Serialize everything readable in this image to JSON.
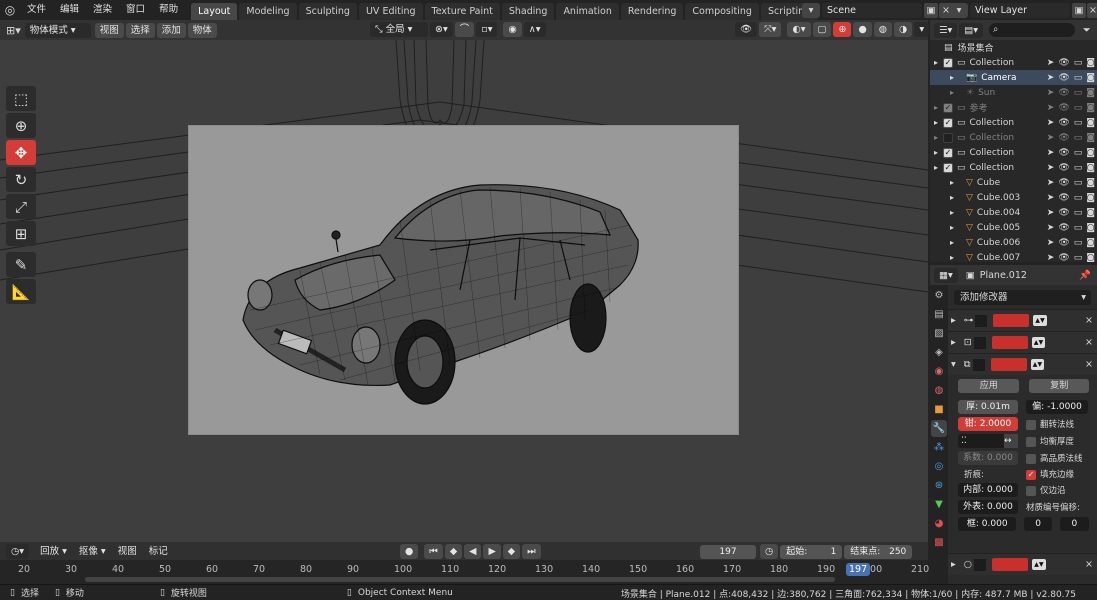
{
  "topbar": {
    "menus": [
      "文件",
      "编辑",
      "渲染",
      "窗口",
      "帮助"
    ],
    "tabs": [
      "Layout",
      "Modeling",
      "Sculpting",
      "UV Editing",
      "Texture Paint",
      "Shading",
      "Animation",
      "Rendering",
      "Compositing",
      "Scripting"
    ],
    "active_tab": "Layout",
    "scene": "Scene",
    "view_layer": "View Layer"
  },
  "viewport_header": {
    "mode": "物体模式",
    "menus": [
      "视图",
      "选择",
      "添加",
      "物体"
    ],
    "orientation": "全局"
  },
  "outliner": {
    "title": "场景集合",
    "rows": [
      {
        "label": "Collection",
        "checked": true,
        "dim": false,
        "kind": "collection"
      },
      {
        "label": "Camera",
        "checked": null,
        "dim": false,
        "kind": "camera",
        "selected": true
      },
      {
        "label": "Sun",
        "checked": null,
        "dim": true,
        "kind": "light"
      },
      {
        "label": "参考",
        "checked": true,
        "dim": true,
        "kind": "collection"
      },
      {
        "label": "Collection",
        "checked": true,
        "dim": false,
        "kind": "collection"
      },
      {
        "label": "Collection",
        "checked": false,
        "dim": true,
        "kind": "collection"
      },
      {
        "label": "Collection",
        "checked": true,
        "dim": false,
        "kind": "collection"
      },
      {
        "label": "Collection",
        "checked": true,
        "dim": false,
        "kind": "collection"
      },
      {
        "label": "Cube",
        "checked": null,
        "dim": false,
        "kind": "mesh"
      },
      {
        "label": "Cube.003",
        "checked": null,
        "dim": false,
        "kind": "mesh"
      },
      {
        "label": "Cube.004",
        "checked": null,
        "dim": false,
        "kind": "mesh"
      },
      {
        "label": "Cube.005",
        "checked": null,
        "dim": false,
        "kind": "mesh"
      },
      {
        "label": "Cube.006",
        "checked": null,
        "dim": false,
        "kind": "mesh"
      },
      {
        "label": "Cube.007",
        "checked": null,
        "dim": false,
        "kind": "mesh"
      }
    ]
  },
  "properties": {
    "object": "Plane.012",
    "add_modifier": "添加修改器",
    "apply": "应用",
    "copy": "复制",
    "thickness": "厚: 0.01m",
    "offset": "偏: -1.0000",
    "clamp": "钳: 2.0000",
    "factor": "系数: 0.000",
    "crease_label": "折痕:",
    "inner": "内部: 0.000",
    "outer": "外表: 0.000",
    "rim": "框: 0.000",
    "flip_normals": "翻转法线",
    "even_thickness": "均衡厚度",
    "hq_normals": "高品质法线",
    "fill_rim": "填充边缘",
    "only_rim": "仅边沿",
    "material_offset_label": "材质编号偏移:",
    "mat_offset_a": "0",
    "mat_offset_b": "0"
  },
  "timeline": {
    "playback": "回放",
    "keying": "抠像",
    "view": "视图",
    "marker": "标记",
    "current_frame": "197",
    "start_label": "起始:",
    "start": "1",
    "end_label": "结束点:",
    "end": "250",
    "ticks": [
      "20",
      "30",
      "40",
      "50",
      "60",
      "70",
      "80",
      "90",
      "100",
      "110",
      "120",
      "130",
      "140",
      "150",
      "160",
      "170",
      "180",
      "190",
      "200",
      "210"
    ],
    "playhead": "197"
  },
  "status": {
    "select": "选择",
    "move": "移动",
    "rotate": "旋转视图",
    "context": "Object Context Menu",
    "stats": "场景集合 | Plane.012 | 点:408,432 | 边:380,762 | 三角面:762,334 | 物体:1/60 | 内存: 487.7 MB | v2.80.75"
  }
}
